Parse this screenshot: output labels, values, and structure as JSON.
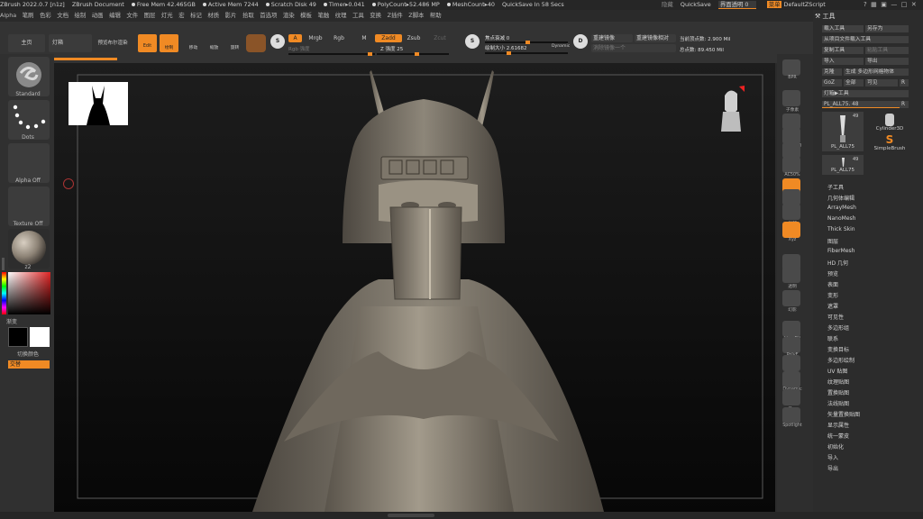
{
  "titlebar": {
    "app": "ZBrush 2022.0.7 [n1z]",
    "doc": "ZBrush Document",
    "free_mem": "Free Mem 42.465GB",
    "active_mem": "Active Mem 7244",
    "scratch": "Scratch Disk 49",
    "timer": "Timer▸0.041",
    "polycount": "PolyCount▸52.486 MP",
    "meshcount": "MeshCount▸40",
    "quicksave_info": "QuickSave In 58 Secs",
    "hide": "隐藏",
    "quicksave": "QuickSave",
    "transparency": "界面透明 0",
    "menu_btn": "菜单",
    "script": "DefaultZScript"
  },
  "menubar": [
    "Alpha",
    "笔刷",
    "色彩",
    "文档",
    "绘制",
    "动画",
    "编辑",
    "文件",
    "图层",
    "灯光",
    "宏",
    "标记",
    "材质",
    "影片",
    "拾取",
    "首选项",
    "渲染",
    "模板",
    "笔触",
    "纹理",
    "工具",
    "变换",
    "Z插件",
    "Z脚本",
    "帮助"
  ],
  "toolbar": {
    "home": "主页",
    "lightbox": "灯箱",
    "preview": "预览布尔渲染",
    "edit": "Edit",
    "draw": "绘制",
    "move": "移动",
    "scale": "缩放",
    "rotate": "旋转",
    "a": "A",
    "mrgb": "Mrgb",
    "rgb": "Rgb",
    "m": "M",
    "zadd": "Zadd",
    "zsub": "Zsub",
    "zcut": "Zcut",
    "rgb_intensity": "Rgb 强度",
    "z_intensity": "Z 强度 25",
    "focal_shift": "焦点衰减 0",
    "draw_size": "绘制大小 2.61682",
    "dynamic": "Dynamic",
    "mirror_weld": "重建镜像",
    "mirror_weld2": "重建镜像相对",
    "mirror_next": "消除镜像一个",
    "active_points": "当前顶点数: 2.900 Mil",
    "total_points": "总点数: 89.450 Mil"
  },
  "left": {
    "brush": "Standard",
    "stroke": "Dots",
    "alpha": "Alpha Off",
    "texture": "Texture Off",
    "material": "z2",
    "gradient": "渐变",
    "switch_color": "切换颜色",
    "alternate": "交替"
  },
  "rightstrip": [
    "BPR",
    "子像素",
    "实际",
    "Zoom3D",
    "100%",
    "AC50%",
    "透视",
    "地板",
    "局部",
    "Xyz",
    "网格",
    "透明",
    "幻影",
    "Line Fill",
    "PolyF",
    "孤立",
    "Dynamic",
    "单一",
    "Spotlight"
  ],
  "toolpanel": {
    "title": "工具",
    "load": "载入工具",
    "save_as": "另存为",
    "load_from_project": "从项目文件载入工具",
    "copy": "复制工具",
    "paste": "粘贴工具",
    "import": "导入",
    "export": "导出",
    "clone": "克隆",
    "make_polymesh": "生成 多边形网格物体",
    "goz": "GoZ",
    "all": "全部",
    "visible": "可见",
    "r": "R",
    "lightbox_tools": "灯箱▶工具",
    "current_tool": "PL_ALL75. 48",
    "thumb1": "PL_ALL75",
    "thumb1_count": "49",
    "thumb2": "Cylinder3D",
    "thumb3": "SimpleBrush",
    "thumb4": "PL_ALL75",
    "thumb4_count": "49",
    "items": [
      "子工具",
      "几何体编辑",
      "ArrayMesh",
      "NanoMesh",
      "Thick Skin",
      "图层",
      "FiberMesh",
      "HD 几何",
      "预览",
      "表面",
      "变形",
      "遮罩",
      "可见性",
      "多边形组",
      "联系",
      "变换目标",
      "多边形绘制",
      "UV 贴图",
      "纹理贴图",
      "置换贴图",
      "法线贴图",
      "矢量置换贴图",
      "显示属性",
      "统一蒙皮",
      "初始化",
      "导入",
      "导出"
    ]
  },
  "colors": {
    "accent": "#f08a24"
  }
}
